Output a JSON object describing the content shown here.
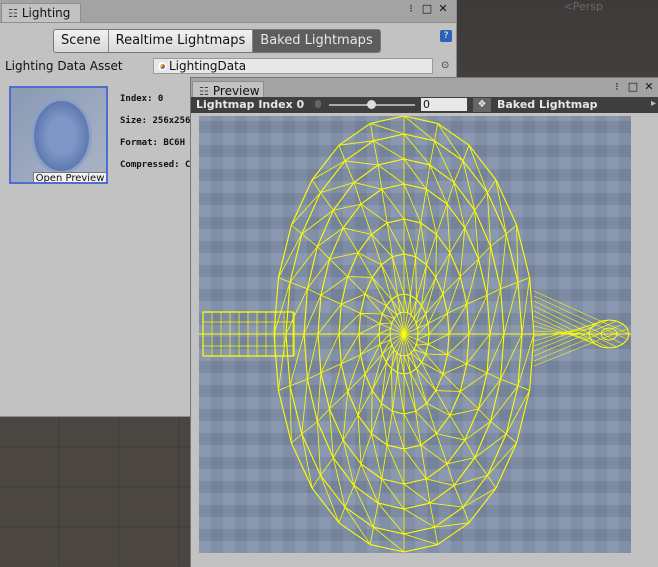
{
  "scene": {
    "persp_label": "<Persp"
  },
  "lighting": {
    "tab_label": "Lighting",
    "tab_icon": "list-icon",
    "window_buttons": [
      "menu-dots-icon",
      "maximize-icon",
      "close-icon"
    ],
    "tabs": [
      {
        "label": "Scene",
        "active": false
      },
      {
        "label": "Realtime Lightmaps",
        "active": false
      },
      {
        "label": "Baked Lightmaps",
        "active": true
      }
    ],
    "asset_label": "Lighting Data Asset",
    "asset_value": "LightingData",
    "open_preview_label": "Open Preview",
    "info": {
      "index": "Index: 0",
      "size": "Size: 256x256",
      "format": "Format: BC6H",
      "compressed": "Compressed: C"
    }
  },
  "preview": {
    "tab_label": "Preview",
    "toolbar_label": "Lightmap Index 0",
    "index_value": "0",
    "mode_label": "Baked Lightmap"
  },
  "colors": {
    "wireframe": "#ffff00",
    "panel_bg": "#c2c2c2",
    "active_tab": "#5d5d5d"
  }
}
